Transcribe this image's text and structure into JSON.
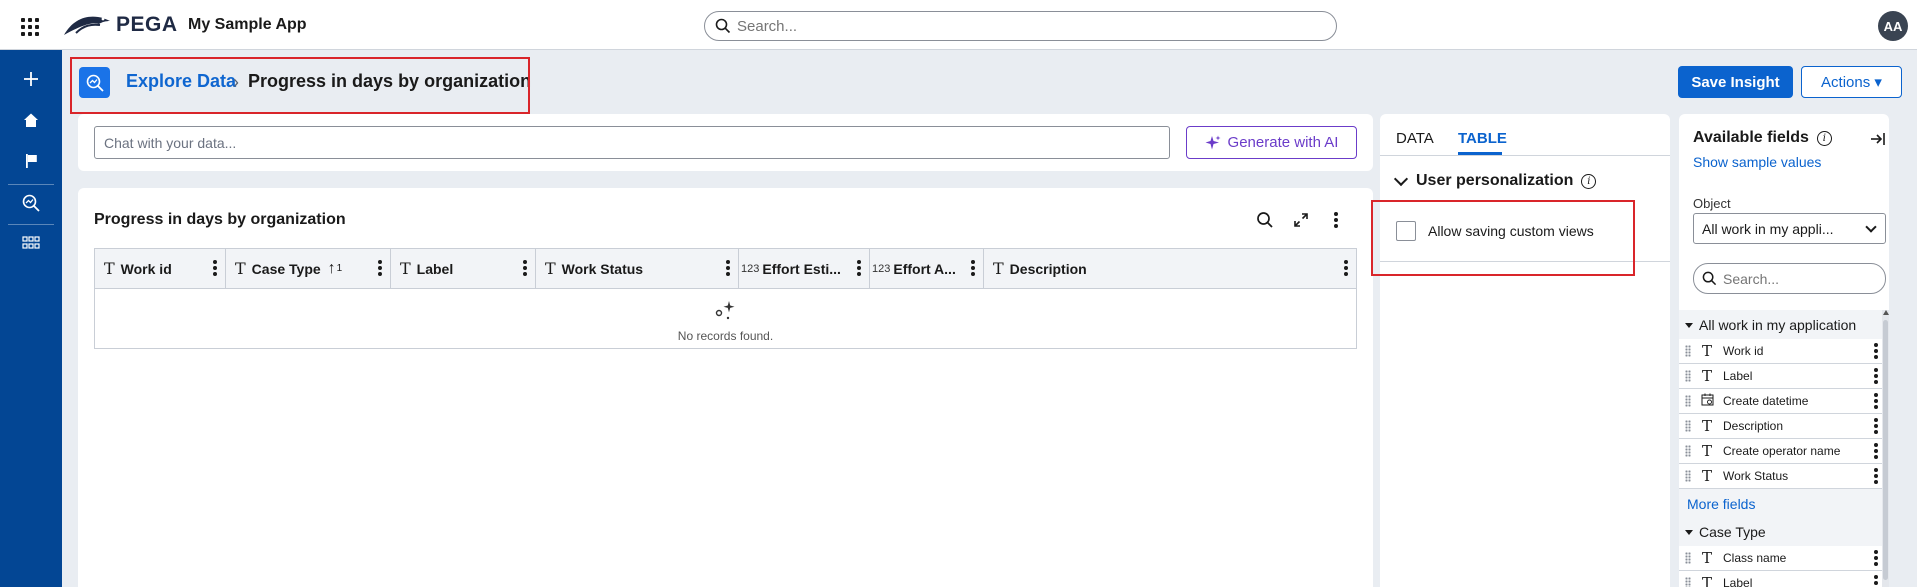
{
  "header": {
    "logo_text": "PEGA",
    "app_name": "My Sample App",
    "search_placeholder": "Search...",
    "avatar_initials": "AA"
  },
  "nav": {
    "items": [
      "add-icon",
      "home-icon",
      "flag-icon",
      "explore-data-icon",
      "apps-grid-icon"
    ]
  },
  "breadcrumb": {
    "link": "Explore Data",
    "separator": "›",
    "current": "Progress in days by organization"
  },
  "actions": {
    "save_label": "Save Insight",
    "actions_label": "Actions ▾"
  },
  "chat": {
    "placeholder": "Chat with your data...",
    "generate_label": "Generate with AI"
  },
  "table": {
    "title": "Progress in days by organization",
    "columns": [
      {
        "type": "T",
        "label": "Work id"
      },
      {
        "type": "T",
        "label": "Case Type",
        "sort": "↑",
        "sort_index": "1"
      },
      {
        "type": "T",
        "label": "Label"
      },
      {
        "type": "T",
        "label": "Work Status"
      },
      {
        "type": "123",
        "label": "Effort Esti..."
      },
      {
        "type": "123",
        "label": "Effort A..."
      },
      {
        "type": "T",
        "label": "Description"
      }
    ],
    "empty_text": "No records found."
  },
  "settings": {
    "tabs": [
      "DATA",
      "TABLE"
    ],
    "active_tab": "TABLE",
    "section_title": "User personalization",
    "checkbox_label": "Allow saving custom views",
    "checkbox_checked": false
  },
  "fields": {
    "title": "Available fields",
    "show_sample": "Show sample values",
    "object_label": "Object",
    "object_value": "All work in my appli...",
    "search_placeholder": "Search...",
    "group1": "All work in my application",
    "group1_items": [
      {
        "type": "T",
        "label": "Work id"
      },
      {
        "type": "T",
        "label": "Label"
      },
      {
        "type": "calendar",
        "label": "Create datetime"
      },
      {
        "type": "T",
        "label": "Description"
      },
      {
        "type": "T",
        "label": "Create operator name"
      },
      {
        "type": "T",
        "label": "Work Status"
      }
    ],
    "more_fields": "More fields",
    "group2": "Case Type",
    "group2_items": [
      {
        "type": "T",
        "label": "Class name"
      },
      {
        "type": "T",
        "label": "Label"
      }
    ]
  },
  "colors": {
    "nav_bg": "#034694",
    "primary": "#0b63ce",
    "ai_purple": "#6b3cc9",
    "highlight": "#d9252a"
  }
}
